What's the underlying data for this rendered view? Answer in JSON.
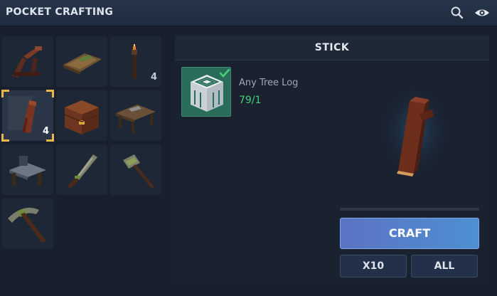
{
  "header": {
    "title": "POCKET CRAFTING",
    "icons": [
      "search-icon",
      "eye-icon"
    ]
  },
  "recipes": [
    {
      "name": "catapult",
      "count": ""
    },
    {
      "name": "wooden-raft",
      "count": ""
    },
    {
      "name": "torch",
      "count": "4"
    },
    {
      "name": "stick",
      "count": "4",
      "selected": true
    },
    {
      "name": "wooden-chest",
      "count": ""
    },
    {
      "name": "crafting-bench",
      "count": ""
    },
    {
      "name": "anvil-bench",
      "count": ""
    },
    {
      "name": "stone-knife",
      "count": ""
    },
    {
      "name": "stone-hammer",
      "count": ""
    },
    {
      "name": "stone-pickaxe",
      "count": ""
    }
  ],
  "detail": {
    "title": "STICK",
    "ingredient": {
      "name": "Any Tree Log",
      "quantity": "79/1",
      "icon": "tree-log-icon",
      "status": "check-icon"
    },
    "progress": 0,
    "buttons": {
      "craft": "CRAFT",
      "x10": "X10",
      "all": "ALL"
    }
  },
  "colors": {
    "accent_gold": "#e9b84a",
    "available_green": "#47d17c",
    "craft_blue": "#5c80cc"
  }
}
